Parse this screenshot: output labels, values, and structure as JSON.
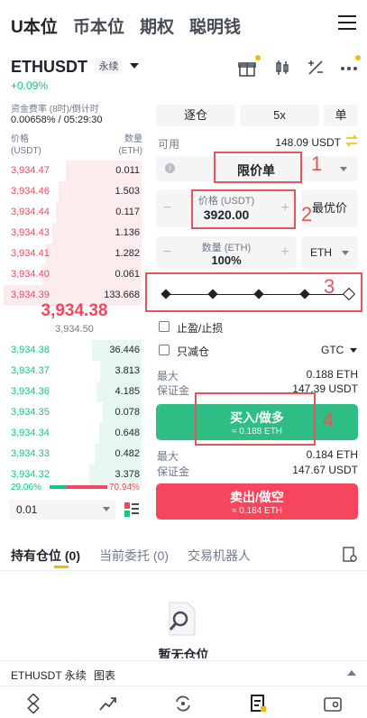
{
  "topnav": {
    "tabs": [
      {
        "label": "U本位",
        "active": true
      },
      {
        "label": "币本位",
        "active": false
      },
      {
        "label": "期权",
        "active": false
      },
      {
        "label": "聪明钱",
        "active": false
      }
    ]
  },
  "symbol": {
    "name": "ETHUSDT",
    "tag": "永续",
    "change": "+0.09%"
  },
  "funding": {
    "label": "资金费率 (8时)/倒计时",
    "value": "0.00658% / 05:29:30"
  },
  "orderbook": {
    "price_header": "价格",
    "price_unit": "(USDT)",
    "qty_header": "数量",
    "qty_unit": "(ETH)",
    "asks": [
      {
        "price": "3,934.47",
        "qty": "0.011",
        "depth": 0.55
      },
      {
        "price": "3,934.46",
        "qty": "1.503",
        "depth": 0.6
      },
      {
        "price": "3,934.44",
        "qty": "0.117",
        "depth": 0.62
      },
      {
        "price": "3,934.43",
        "qty": "1.136",
        "depth": 0.65
      },
      {
        "price": "3,934.41",
        "qty": "1.282",
        "depth": 0.7
      },
      {
        "price": "3,934.40",
        "qty": "0.061",
        "depth": 0.72
      },
      {
        "price": "3,934.39",
        "qty": "133.668",
        "depth": 1.0
      }
    ],
    "mid_price": "3,934.38",
    "mark_price": "3,934.50",
    "bids": [
      {
        "price": "3,934.38",
        "qty": "36.446",
        "depth": 0.36
      },
      {
        "price": "3,934.37",
        "qty": "3.813",
        "depth": 0.3
      },
      {
        "price": "3,934.36",
        "qty": "4.185",
        "depth": 0.33
      },
      {
        "price": "3,934.35",
        "qty": "0.078",
        "depth": 0.28
      },
      {
        "price": "3,934.34",
        "qty": "0.648",
        "depth": 0.31
      },
      {
        "price": "3,934.33",
        "qty": "0.482",
        "depth": 0.34
      },
      {
        "price": "3,934.32",
        "qty": "3.378",
        "depth": 0.38
      }
    ],
    "bid_ratio": "29.06%",
    "ask_ratio": "70.94%",
    "bid_fraction": 0.2906,
    "depth_step": "0.01"
  },
  "form": {
    "margin_mode": "逐仓",
    "leverage": "5x",
    "position_mode": "单",
    "available_label": "可用",
    "available_value": "148.09 USDT",
    "order_type": "限价单",
    "price_label": "价格 (USDT)",
    "price_value": "3920.00",
    "best_price": "最优价",
    "qty_label": "数量 (ETH)",
    "qty_value": "100%",
    "qty_unit": "ETH",
    "slider_level": 1.0,
    "tpsl_label": "止盈/止损",
    "reduce_only_label": "只减仓",
    "tif": "GTC",
    "buy": {
      "max_label": "最大",
      "max_value": "0.188 ETH",
      "margin_label": "保证金",
      "margin_value": "147.39 USDT",
      "label": "买入/做多",
      "sub": "≈ 0.188 ETH"
    },
    "sell": {
      "max_label": "最大",
      "max_value": "0.184 ETH",
      "margin_label": "保证金",
      "margin_value": "147.67 USDT",
      "label": "卖出/做空",
      "sub": "≈ 0.184 ETH"
    }
  },
  "annotations": [
    "1",
    "2",
    "3",
    "4"
  ],
  "section_tabs": [
    {
      "label": "持有仓位 (0)",
      "active": true
    },
    {
      "label": "当前委托 (0)",
      "active": false
    },
    {
      "label": "交易机器人",
      "active": false
    }
  ],
  "empty_text": "暂无仓位",
  "chart_bar": {
    "symbol": "ETHUSDT 永续",
    "label": "图表"
  },
  "colors": {
    "buy": "#2ebd85",
    "sell": "#f6465d",
    "accent": "#f0b90b"
  }
}
